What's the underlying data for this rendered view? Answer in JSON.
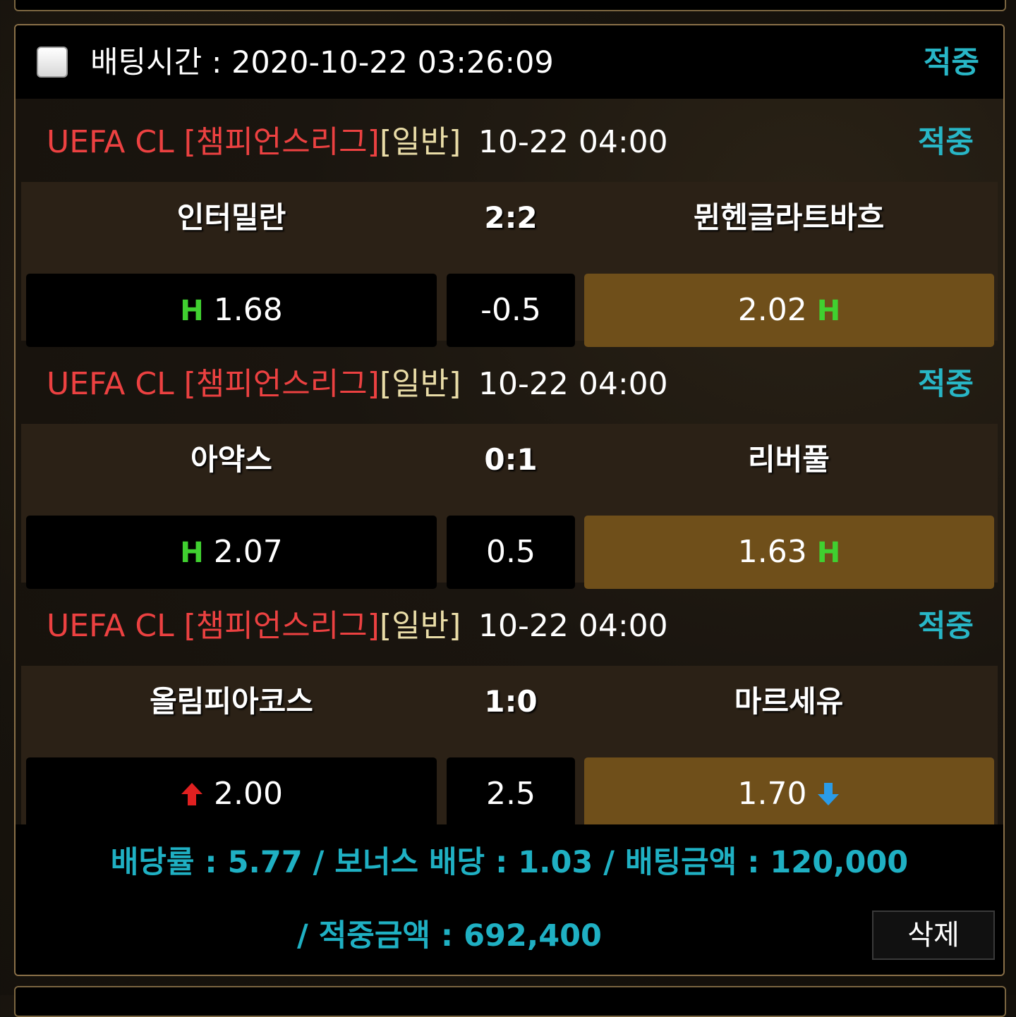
{
  "header": {
    "bet_time": "배팅시간 : 2020-10-22 03:26:09",
    "status": "적중"
  },
  "games": [
    {
      "league": "UEFA CL [챔피언스리그]",
      "type": "[일반]",
      "kickoff": "10-22 04:00",
      "status": "적중",
      "home_team": "인터밀란",
      "score": "2:2",
      "away_team": "뮌헨글라트바흐",
      "home_odds": "1.68",
      "handicap": "-0.5",
      "away_odds": "2.02",
      "home_marker": "H",
      "away_marker": "H",
      "selected": "away"
    },
    {
      "league": "UEFA CL [챔피언스리그]",
      "type": "[일반]",
      "kickoff": "10-22 04:00",
      "status": "적중",
      "home_team": "아약스",
      "score": "0:1",
      "away_team": "리버풀",
      "home_odds": "2.07",
      "handicap": "0.5",
      "away_odds": "1.63",
      "home_marker": "H",
      "away_marker": "H",
      "selected": "away"
    },
    {
      "league": "UEFA CL [챔피언스리그]",
      "type": "[일반]",
      "kickoff": "10-22 04:00",
      "status": "적중",
      "home_team": "올림피아코스",
      "score": "1:0",
      "away_team": "마르세유",
      "home_odds": "2.00",
      "handicap": "2.5",
      "away_odds": "1.70",
      "home_marker": "up-arrow-icon",
      "away_marker": "down-arrow-icon",
      "selected": "away"
    }
  ],
  "summary": {
    "line1": "배당률 : 5.77 / 보너스 배당 : 1.03 / 배팅금액 : 120,000",
    "line2": "/ 적중금액 : 692,400",
    "delete_label": "삭제"
  },
  "colors": {
    "league": "#ec4141",
    "status": "#28b6c6",
    "selected_odds_bg": "#6f4f1a",
    "h_marker": "#40d030",
    "up_arrow": "#e02020",
    "down_arrow": "#2a9be8"
  }
}
